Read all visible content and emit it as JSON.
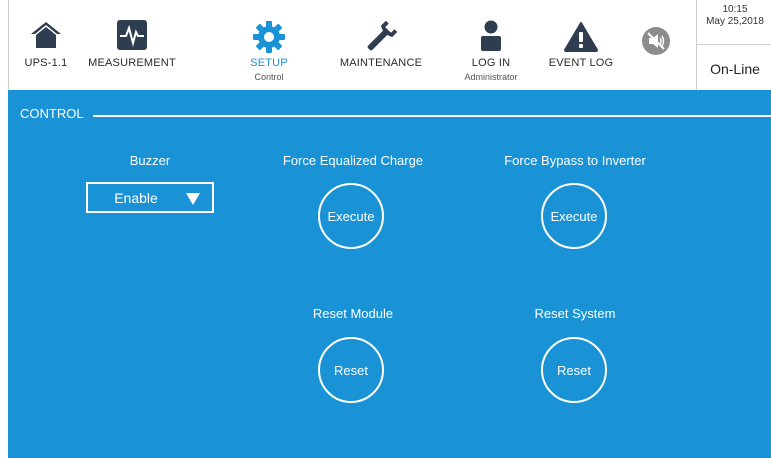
{
  "nav": {
    "items": [
      {
        "label": "UPS-1.1",
        "sub": "",
        "icon": "home-icon"
      },
      {
        "label": "MEASUREMENT",
        "sub": "",
        "icon": "waveform-icon"
      },
      {
        "label": "SETUP",
        "sub": "Control",
        "icon": "gear-icon"
      },
      {
        "label": "MAINTENANCE",
        "sub": "",
        "icon": "wrench-icon"
      },
      {
        "label": "LOG IN",
        "sub": "Administrator",
        "icon": "user-icon"
      },
      {
        "label": "EVENT LOG",
        "sub": "",
        "icon": "warning-icon"
      }
    ],
    "mute_icon": "speaker-muted-icon"
  },
  "status": {
    "time": "10:15",
    "date": "May 25,2018",
    "state": "On-Line"
  },
  "control": {
    "section_title": "CONTROL",
    "buzzer": {
      "label": "Buzzer",
      "value": "Enable"
    },
    "force_equalized_charge": {
      "label": "Force Equalized Charge",
      "button": "Execute"
    },
    "force_bypass": {
      "label": "Force Bypass to Inverter",
      "button": "Execute"
    },
    "reset_module": {
      "label": "Reset Module",
      "button": "Reset"
    },
    "reset_system": {
      "label": "Reset System",
      "button": "Reset"
    }
  },
  "colors": {
    "accent": "#1a93d6",
    "icon_dark": "#2e3d4f",
    "active": "#1a93d6"
  }
}
